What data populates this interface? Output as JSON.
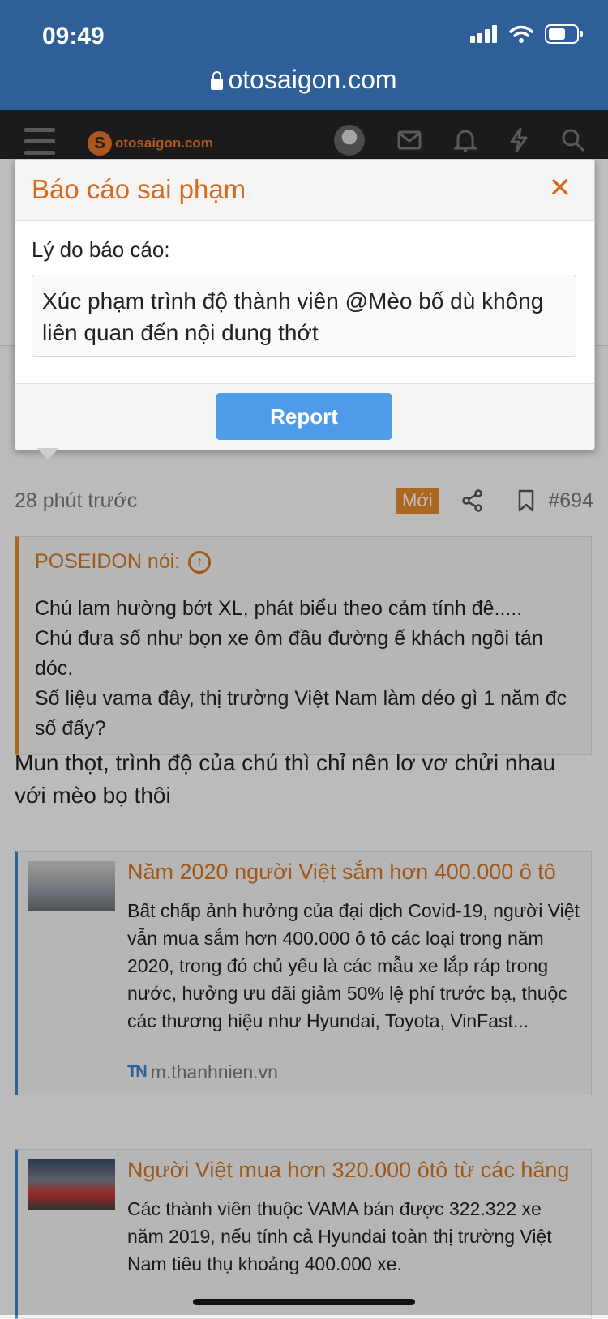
{
  "status_bar": {
    "time": "09:49"
  },
  "browser": {
    "url": "otosaigon.com"
  },
  "site_header": {
    "logo_text": "otosaigon.com"
  },
  "post": {
    "time_ago": "28 phút trước",
    "new_badge": "Mới",
    "post_number": "#694",
    "quote": {
      "author_line": "POSEIDON nói:",
      "body": "Chú lam hường bớt XL, phát biểu theo cảm tính đê.....\nChú đưa số như bọn xe ôm đầu đường ế khách ngồi tán dóc.\nSố liệu vama đây, thị trường Việt Nam làm déo gì 1 năm đc số đấy?"
    },
    "reply": "Mun thọt, trình độ của chú thì chỉ nên lơ vơ chửi nhau với mèo bọ thôi",
    "link_cards": [
      {
        "title": "Năm 2020 người Việt sắm hơn 400.000 ô tô",
        "body": "Bất chấp ảnh hưởng của đại dịch Covid-19, người Việt vẫn mua sắm hơn 400.000 ô tô các loại trong năm 2020, trong đó chủ yếu là các mẫu xe lắp ráp trong nước, hưởng ưu đãi giảm 50% lệ phí trước bạ, thuộc các thương hiệu như Hyundai, Toyota, VinFast...",
        "source": "m.thanhnien.vn",
        "source_logo": "TN"
      },
      {
        "title": "Người Việt mua hơn 320.000 ôtô từ các hãng",
        "body": "Các thành viên thuộc VAMA bán được 322.322 xe năm 2019, nếu tính cả Hyundai toàn thị trường Việt Nam tiêu thụ khoảng 400.000 xe."
      }
    ]
  },
  "modal": {
    "title": "Báo cáo sai phạm",
    "close_glyph": "✕",
    "reason_label": "Lý do báo cáo:",
    "reason_text": "Xúc phạm trình độ thành viên @Mèo bố dù không liên quan đến nội dung thớt",
    "submit_label": "Report"
  },
  "colors": {
    "accent": "#d66b1f",
    "browser_bar": "#2f5f98",
    "button": "#4e9ce8"
  }
}
